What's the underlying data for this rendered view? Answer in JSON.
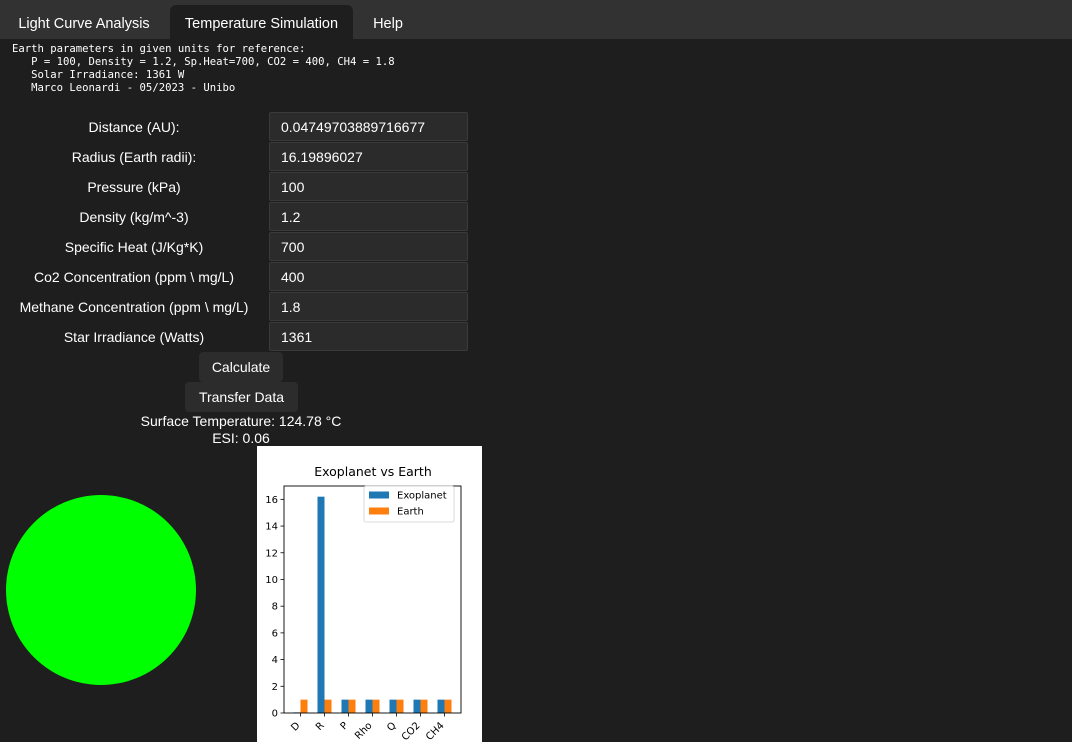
{
  "tabs": [
    {
      "label": "Light Curve Analysis",
      "active": false
    },
    {
      "label": "Temperature Simulation",
      "active": true
    },
    {
      "label": "Help",
      "active": false
    }
  ],
  "reference_note": {
    "line1": "Earth parameters in given units for reference:",
    "line2": "   P = 100, Density = 1.2, Sp.Heat=700, CO2 = 400, CH4 = 1.8",
    "line3": "   Solar Irradiance: 1361 W",
    "line4": "   Marco Leonardi - 05/2023 - Unibo"
  },
  "params": [
    {
      "label": "Distance (AU):",
      "value": "0.04749703889716677"
    },
    {
      "label": "Radius (Earth radii):",
      "value": "16.19896027"
    },
    {
      "label": "Pressure (kPa)",
      "value": "100"
    },
    {
      "label": "Density (kg/m^-3)",
      "value": "1.2"
    },
    {
      "label": "Specific Heat (J/Kg*K)",
      "value": "700"
    },
    {
      "label": "Co2 Concentration (ppm \\ mg/L)",
      "value": "400"
    },
    {
      "label": "Methane Concentration (ppm \\ mg/L)",
      "value": "1.8"
    },
    {
      "label": "Star Irradiance (Watts)",
      "value": "1361"
    }
  ],
  "buttons": {
    "calculate": "Calculate",
    "transfer": "Transfer Data"
  },
  "results": {
    "surface_temperature": "Surface Temperature: 124.78 °C",
    "esi": "ESI: 0.06"
  },
  "planet": {
    "color": "#00ff00"
  },
  "chart_data": {
    "type": "bar",
    "title": "Exoplanet vs Earth",
    "xlabel": "",
    "ylabel": "",
    "categories": [
      "D",
      "R",
      "P",
      "Rho",
      "Q",
      "CO2",
      "CH4"
    ],
    "series": [
      {
        "name": "Exoplanet",
        "color": "#1f77b4",
        "values": [
          0.047,
          16.2,
          1,
          1,
          1,
          1,
          1
        ]
      },
      {
        "name": "Earth",
        "color": "#ff7f0e",
        "values": [
          1,
          1,
          1,
          1,
          1,
          1,
          1
        ]
      }
    ],
    "ylim": [
      0,
      17
    ],
    "yticks": [
      0,
      2,
      4,
      6,
      8,
      10,
      12,
      14,
      16
    ],
    "legend": "top-right",
    "grid": false
  }
}
